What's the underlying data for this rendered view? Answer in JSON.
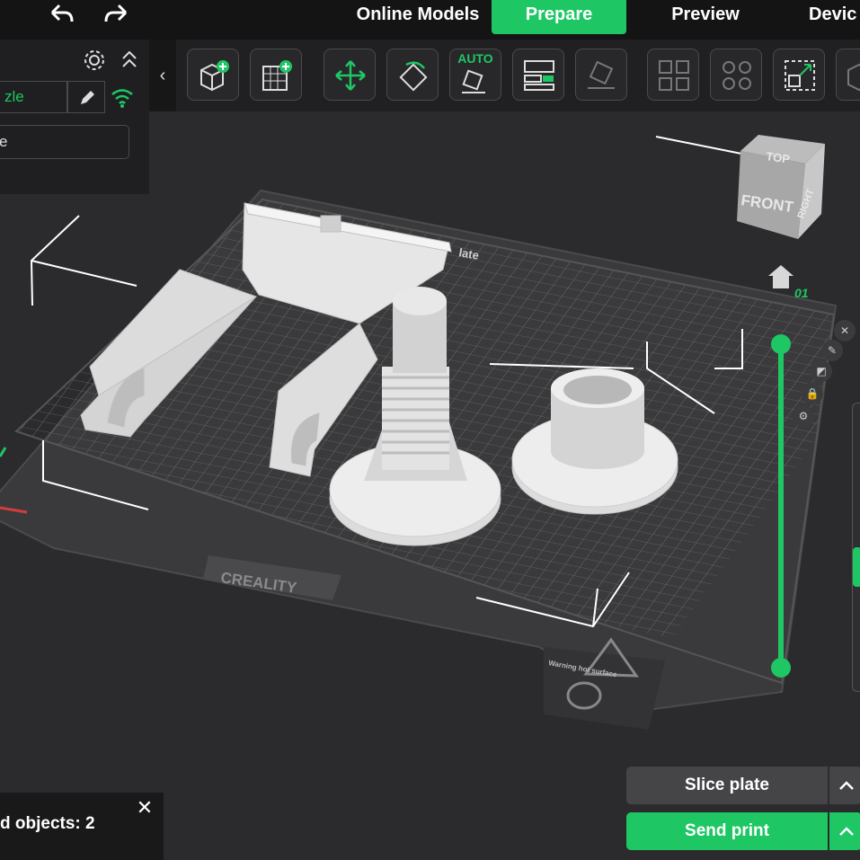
{
  "top_nav": {
    "online_models": "Online Models",
    "prepare": "Prepare",
    "preview": "Preview",
    "device": "Devic"
  },
  "left_panel": {
    "nozzle_value": "zle",
    "second_value": "e"
  },
  "toolbar": {
    "auto_label": "AUTO"
  },
  "viewport": {
    "bed_label": "late",
    "brand": "CREALITY",
    "warning_text": "Warning hot surface",
    "viewcube": {
      "top": "TOP",
      "front": "FRONT",
      "right": "RIGHT"
    },
    "layer_label": "01"
  },
  "actions": {
    "slice_label": "Slice plate",
    "send_label": "Send print"
  },
  "notification": {
    "text": "d objects: 2"
  },
  "colors": {
    "accent": "#1ec764",
    "background": "#2b2b2d"
  }
}
